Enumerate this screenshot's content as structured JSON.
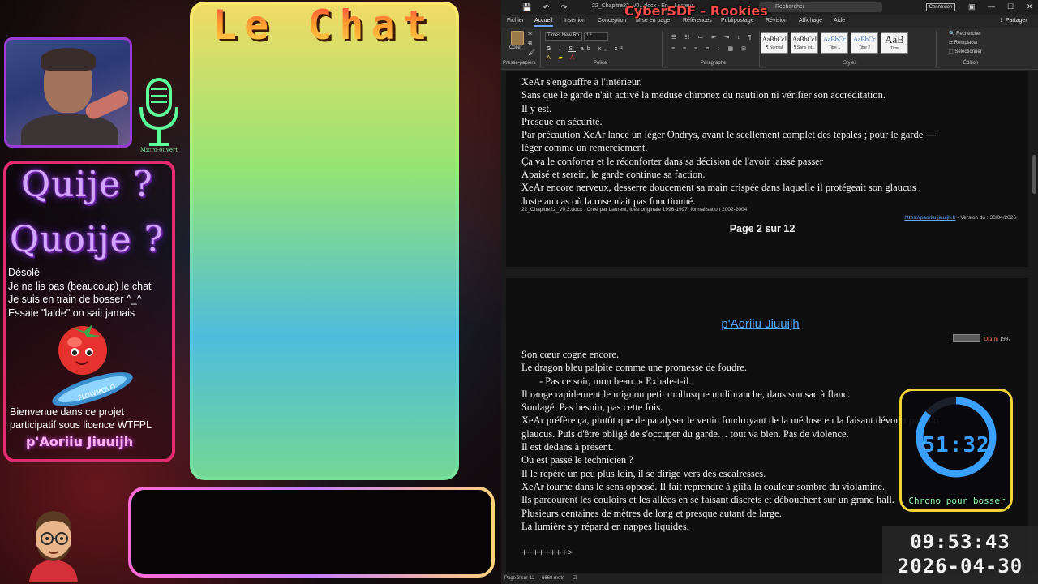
{
  "overlay": {
    "chat_title": "Le Chat",
    "mic_label": "Micro-ouvert",
    "quije": "Quije ?",
    "quoije": "Quoije ?",
    "info_lines": [
      "Désolé",
      "Je ne lis pas (beaucoup) le chat",
      "Je suis en train de bosser ^_^",
      "Essaie \"laide\" on sait jamais"
    ],
    "welcome_lines": [
      "Bienvenue dans ce projet",
      "participatif sous licence WTFPL"
    ],
    "author": "p'Aoriiu Jiuuijh",
    "mascot_text": "FLOWMOVO",
    "cybersdf": "CyberSDF - Rookies"
  },
  "word": {
    "doc_name": "22_Chapitre22_V0...docx - En... Lecteur...",
    "search_placeholder": "Rechercher",
    "connect_label": "Connexion",
    "share_label": "Partager",
    "menu": [
      "Fichier",
      "Accueil",
      "Insertion",
      "Conception",
      "Mise en page",
      "Références",
      "Publipostage",
      "Révision",
      "Affichage",
      "Aide"
    ],
    "active_menu": "Accueil",
    "ribbon": {
      "paste_label": "Coller",
      "font_name": "Times New Ro",
      "font_size": "12",
      "groups": [
        "Presse-papiers",
        "Police",
        "Paragraphe",
        "Styles",
        "Édition"
      ],
      "styles": [
        {
          "sample": "AaBbCcI",
          "name": "¶ Normal"
        },
        {
          "sample": "AaBbCcI",
          "name": "¶ Sans int..."
        },
        {
          "sample": "AaBbCc",
          "name": "Titre 1"
        },
        {
          "sample": "AaBbCc",
          "name": "Titre 2"
        },
        {
          "sample": "AaB",
          "name": "Titre"
        }
      ],
      "edit_items": [
        "Rechercher",
        "Remplacer",
        "Sélectionner"
      ]
    },
    "page1": {
      "lines": [
        "XeAr s'engouffre à l'intérieur.",
        "Sans que le garde n'ait activé la méduse chironex du nautilon ni vérifier son accréditation.",
        "Il y est.",
        "Presque en sécurité.",
        "Par précaution XeAr lance un léger Ondrys, avant le scellement complet des tépales ; pour le garde —",
        "léger comme un remerciement.",
        "Ça va le conforter et le réconforter dans sa décision de l'avoir laissé passer",
        "Apaisé et serein, le garde continue sa faction.",
        "XeAr encore nerveux, desserre doucement sa main crispée dans laquelle il protégeait son glaucus .",
        "Juste au cas où la ruse n'ait pas fonctionné."
      ],
      "footer_left": "22_Chapitre22_V0.2.docx : Créé par Laurent, idée originale 1996-1997, formalisation 2002-2004",
      "footer_link": "https://paoriiu.jiuuijh.fr",
      "footer_version": " - Version du : 30/04/2026",
      "page_number": "Page 2 sur 12"
    },
    "page2": {
      "chapter_title": "p'Aoriiu Jiuuijh",
      "cc_author": "Dfalm",
      "cc_year": " 1997",
      "lines": [
        "Son cœur cogne encore.",
        "Le dragon bleu palpite comme une promesse de foudre.",
        "-     Pas ce soir, mon beau. » Exhale-t-il.",
        "Il range rapidement le mignon petit mollusque nudibranche, dans son sac à flanc.",
        "Soulagé. Pas besoin, pas cette fois.",
        "XeAr préfère ça, plutôt que de paralyser le venin foudroyant de la méduse en la faisant dévorer par son",
        "glaucus. Puis d'être obligé de s'occuper du garde… tout va bien. Pas de violence.",
        "Il est dedans à présent.",
        "Où est passé le technicien ?",
        "Il le repère un peu plus loin, il se dirige vers des escalresses.",
        "XeAr tourne dans le sens opposé. Il fait reprendre à giifa la couleur sombre du violamine.",
        "Ils parcourent les couloirs et les allées en se faisant discrets et débouchent sur un grand hall.",
        "Plusieurs centaines de mètres de long et presque autant de large.",
        "La lumière s'y répand en nappes liquides.",
        "",
        "++++++++>"
      ]
    },
    "status": {
      "page": "Page 3 sur 12",
      "words": "6668 mots"
    }
  },
  "chrono": {
    "time": "51:32",
    "label": "Chrono pour bosser",
    "progress": 0.86,
    "ring_color": "#3aa0ff"
  },
  "clock": {
    "time": "09:53:43",
    "date": "2026-04-30"
  }
}
